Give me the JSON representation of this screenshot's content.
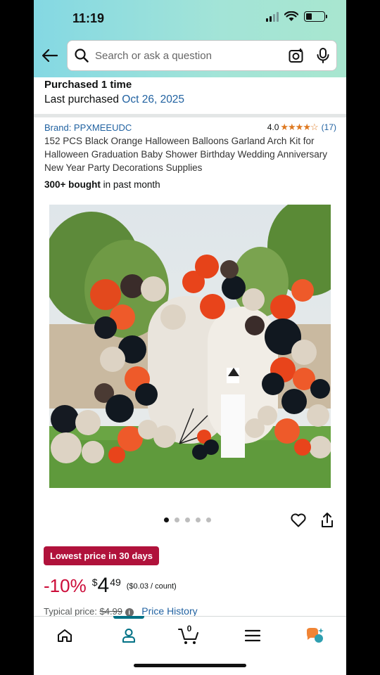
{
  "status_bar": {
    "time": "11:19"
  },
  "search": {
    "placeholder": "Search or ask a question"
  },
  "purchase_info": {
    "times_label": "Purchased 1 time",
    "last_label": "Last purchased ",
    "last_date": "Oct 26, 2025"
  },
  "product": {
    "brand": "Brand: PPXMEEUDC",
    "rating_value": "4.0",
    "stars": "★★★★☆",
    "review_count": "(17)",
    "title": "152 PCS Black Orange Halloween Balloons Garland Arch Kit for Halloween Graduation Baby Shower Birthday Wedding Anniversary New Year Party Decorations Supplies",
    "bought_bold": "300+ bought",
    "bought_rest": " in past month"
  },
  "carousel": {
    "count": 5,
    "active": 1
  },
  "pricing": {
    "badge": "Lowest price in 30 days",
    "discount": "-10%",
    "currency": "$",
    "price_whole": "4",
    "price_fraction": "49",
    "unit_price": "($0.03 / count)",
    "typical_label": "Typical price: ",
    "typical_value": "$4.99",
    "info_glyph": "i",
    "history_link": "Price History"
  },
  "bottom_nav": {
    "items": [
      "home",
      "account",
      "cart",
      "menu",
      "rufus"
    ],
    "active": "account",
    "cart_count": "0"
  },
  "colors": {
    "link": "#2162a1",
    "star": "#de7921",
    "deal": "#cc0c39",
    "badge_bg": "#b0123b",
    "nav_active": "#007185"
  }
}
